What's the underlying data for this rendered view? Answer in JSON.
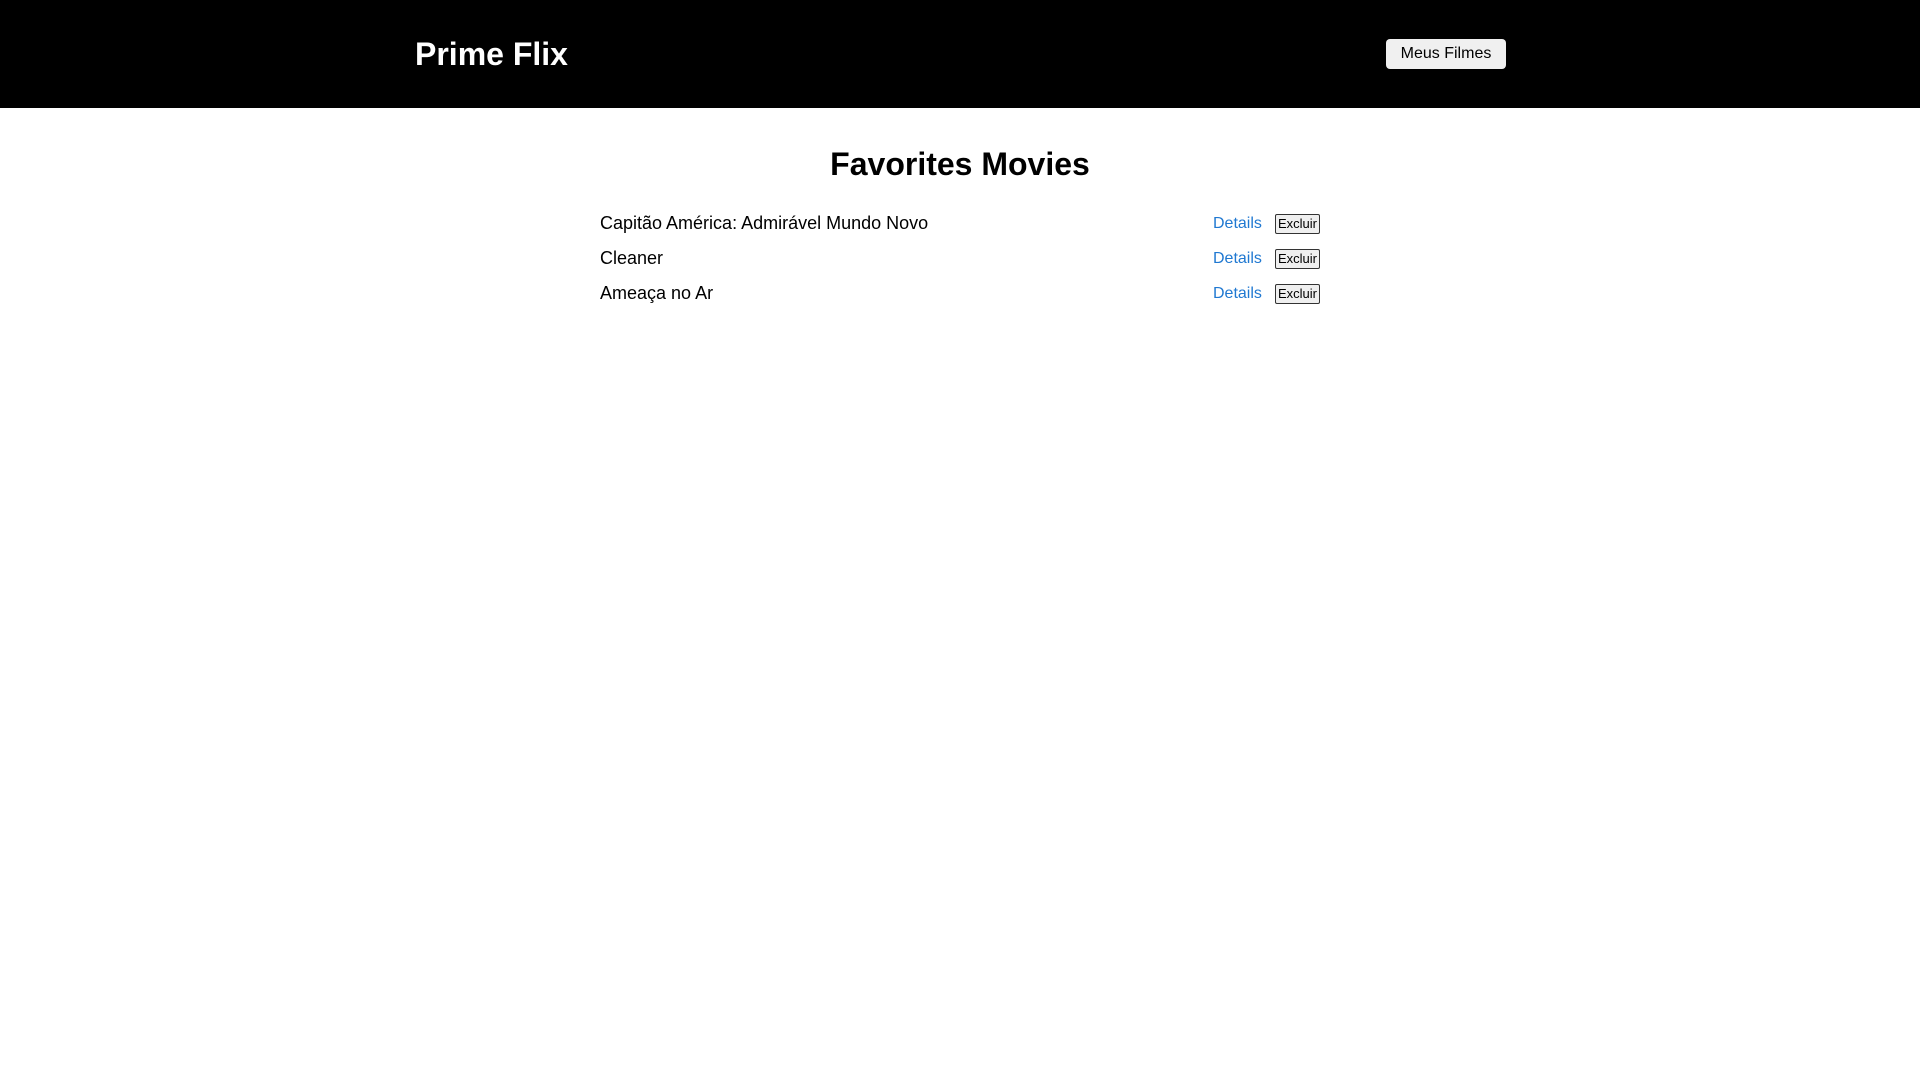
{
  "header": {
    "logo": "Prime Flix",
    "nav_button": "Meus Filmes"
  },
  "main": {
    "title": "Favorites Movies",
    "movies": [
      {
        "title": "Capitão América: Admirável Mundo Novo",
        "details_label": "Details",
        "delete_label": "Excluir"
      },
      {
        "title": "Cleaner",
        "details_label": "Details",
        "delete_label": "Excluir"
      },
      {
        "title": "Ameaça no Ar",
        "details_label": "Details",
        "delete_label": "Excluir"
      }
    ]
  },
  "colors": {
    "header_background": "#000000",
    "link": "#1f78d1"
  }
}
